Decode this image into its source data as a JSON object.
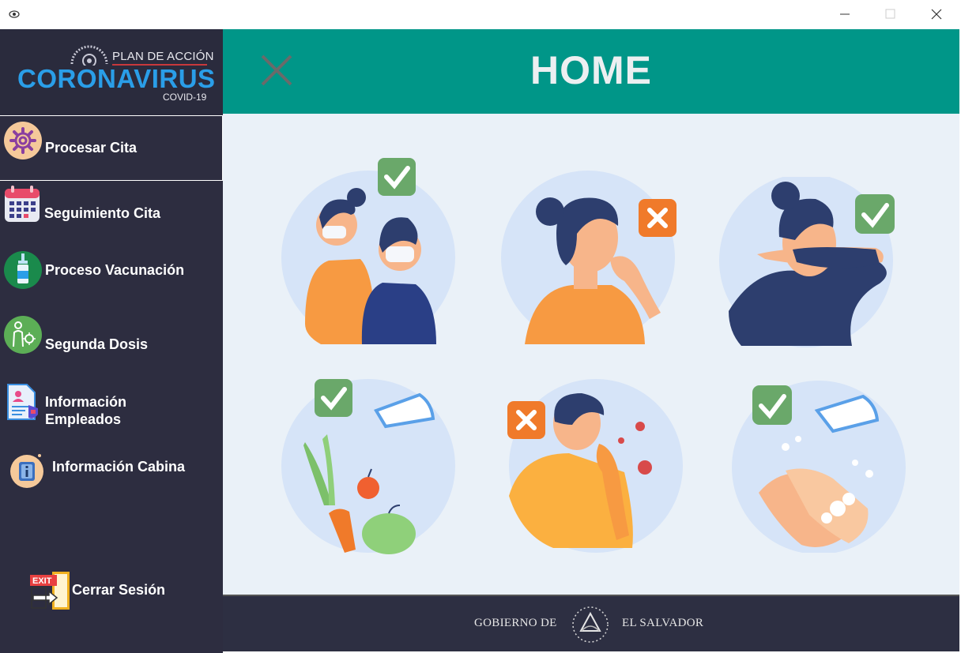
{
  "window": {
    "minimize_icon": "minimize-icon",
    "maximize_icon": "maximize-icon",
    "close_icon": "close-icon"
  },
  "logo": {
    "plan": "PLAN DE ACCIÓN",
    "brand": "CORONAVIRUS",
    "sub": "COVID-19"
  },
  "sidebar": {
    "items": [
      {
        "label": "Procesar Cita",
        "icon": "gear-icon"
      },
      {
        "label": "Seguimiento Cita",
        "icon": "calendar-icon"
      },
      {
        "label": "Proceso Vacunación",
        "icon": "vaccine-icon"
      },
      {
        "label": "Segunda Dosis",
        "icon": "person-virus-icon"
      },
      {
        "label": "Información Empleados",
        "icon": "employee-document-icon"
      },
      {
        "label": "Información Cabina",
        "icon": "info-icon"
      }
    ],
    "logout": {
      "label": "Cerrar Sesión",
      "icon": "exit-door-icon"
    }
  },
  "header": {
    "title": "HOME",
    "close_icon": "close-x-icon"
  },
  "footer": {
    "left_text": "GOBIERNO DE",
    "right_text": "EL SALVADOR"
  },
  "colors": {
    "sidebar": "#2d2d40",
    "header": "#009688",
    "content": "#eaf1f8",
    "check": "#6aa86a",
    "cross": "#f07a2a"
  }
}
